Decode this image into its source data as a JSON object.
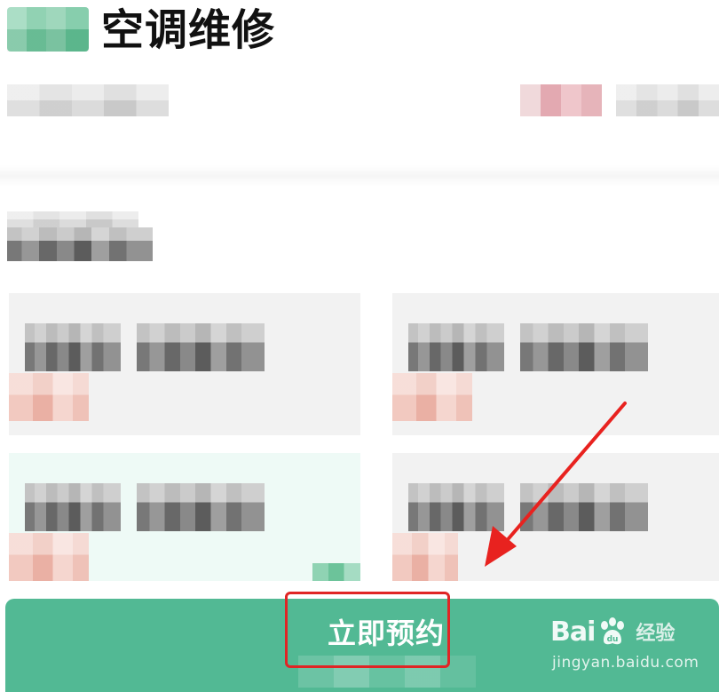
{
  "header": {
    "title": "空调维修"
  },
  "action_bar": {
    "book_now_label": "立即预约"
  },
  "watermark": {
    "brand_left": "Bai",
    "brand_right": "经验",
    "url": "jingyan.baidu.com"
  },
  "colors": {
    "accent_green": "#52b994",
    "highlight_red": "#e02525",
    "arrow_red": "#e8221f",
    "card_bg": "#f2f2f2",
    "card_selected_bg": "#eefaf6"
  }
}
